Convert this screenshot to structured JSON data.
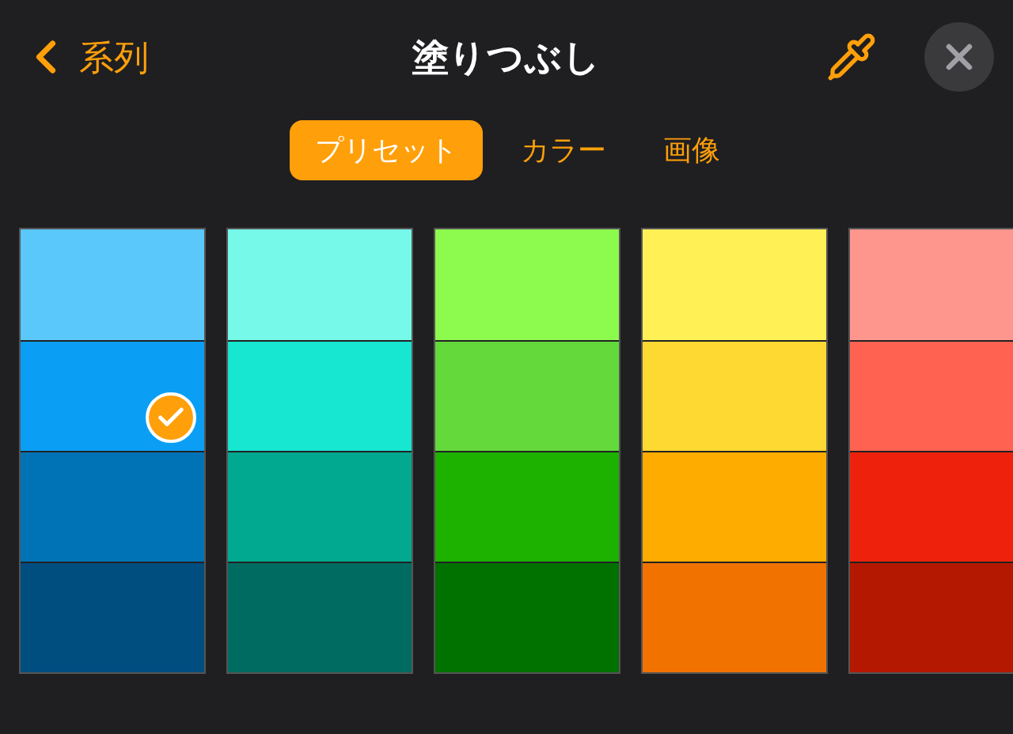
{
  "header": {
    "back_label": "系列",
    "title": "塗りつぶし"
  },
  "tabs": [
    {
      "label": "プリセット",
      "selected": true
    },
    {
      "label": "カラー",
      "selected": false
    },
    {
      "label": "画像",
      "selected": false
    }
  ],
  "swatch_columns": [
    {
      "swatches": [
        {
          "color": "#5ac8fa",
          "selected": false
        },
        {
          "color": "#0a9ff5",
          "selected": true
        },
        {
          "color": "#0073b6",
          "selected": false
        },
        {
          "color": "#004d7f",
          "selected": false
        }
      ]
    },
    {
      "swatches": [
        {
          "color": "#76f9e9",
          "selected": false
        },
        {
          "color": "#17e6d1",
          "selected": false
        },
        {
          "color": "#00a98f",
          "selected": false
        },
        {
          "color": "#006b61",
          "selected": false
        }
      ]
    },
    {
      "swatches": [
        {
          "color": "#8dfa4e",
          "selected": false
        },
        {
          "color": "#63d93b",
          "selected": false
        },
        {
          "color": "#1db100",
          "selected": false
        },
        {
          "color": "#017100",
          "selected": false
        }
      ]
    },
    {
      "swatches": [
        {
          "color": "#fff056",
          "selected": false
        },
        {
          "color": "#fed932",
          "selected": false
        },
        {
          "color": "#ffac00",
          "selected": false
        },
        {
          "color": "#f27200",
          "selected": false
        }
      ]
    },
    {
      "swatches": [
        {
          "color": "#ff968d",
          "selected": false
        },
        {
          "color": "#ff6251",
          "selected": false
        },
        {
          "color": "#ee220c",
          "selected": false
        },
        {
          "color": "#b51800",
          "selected": false
        }
      ]
    }
  ]
}
